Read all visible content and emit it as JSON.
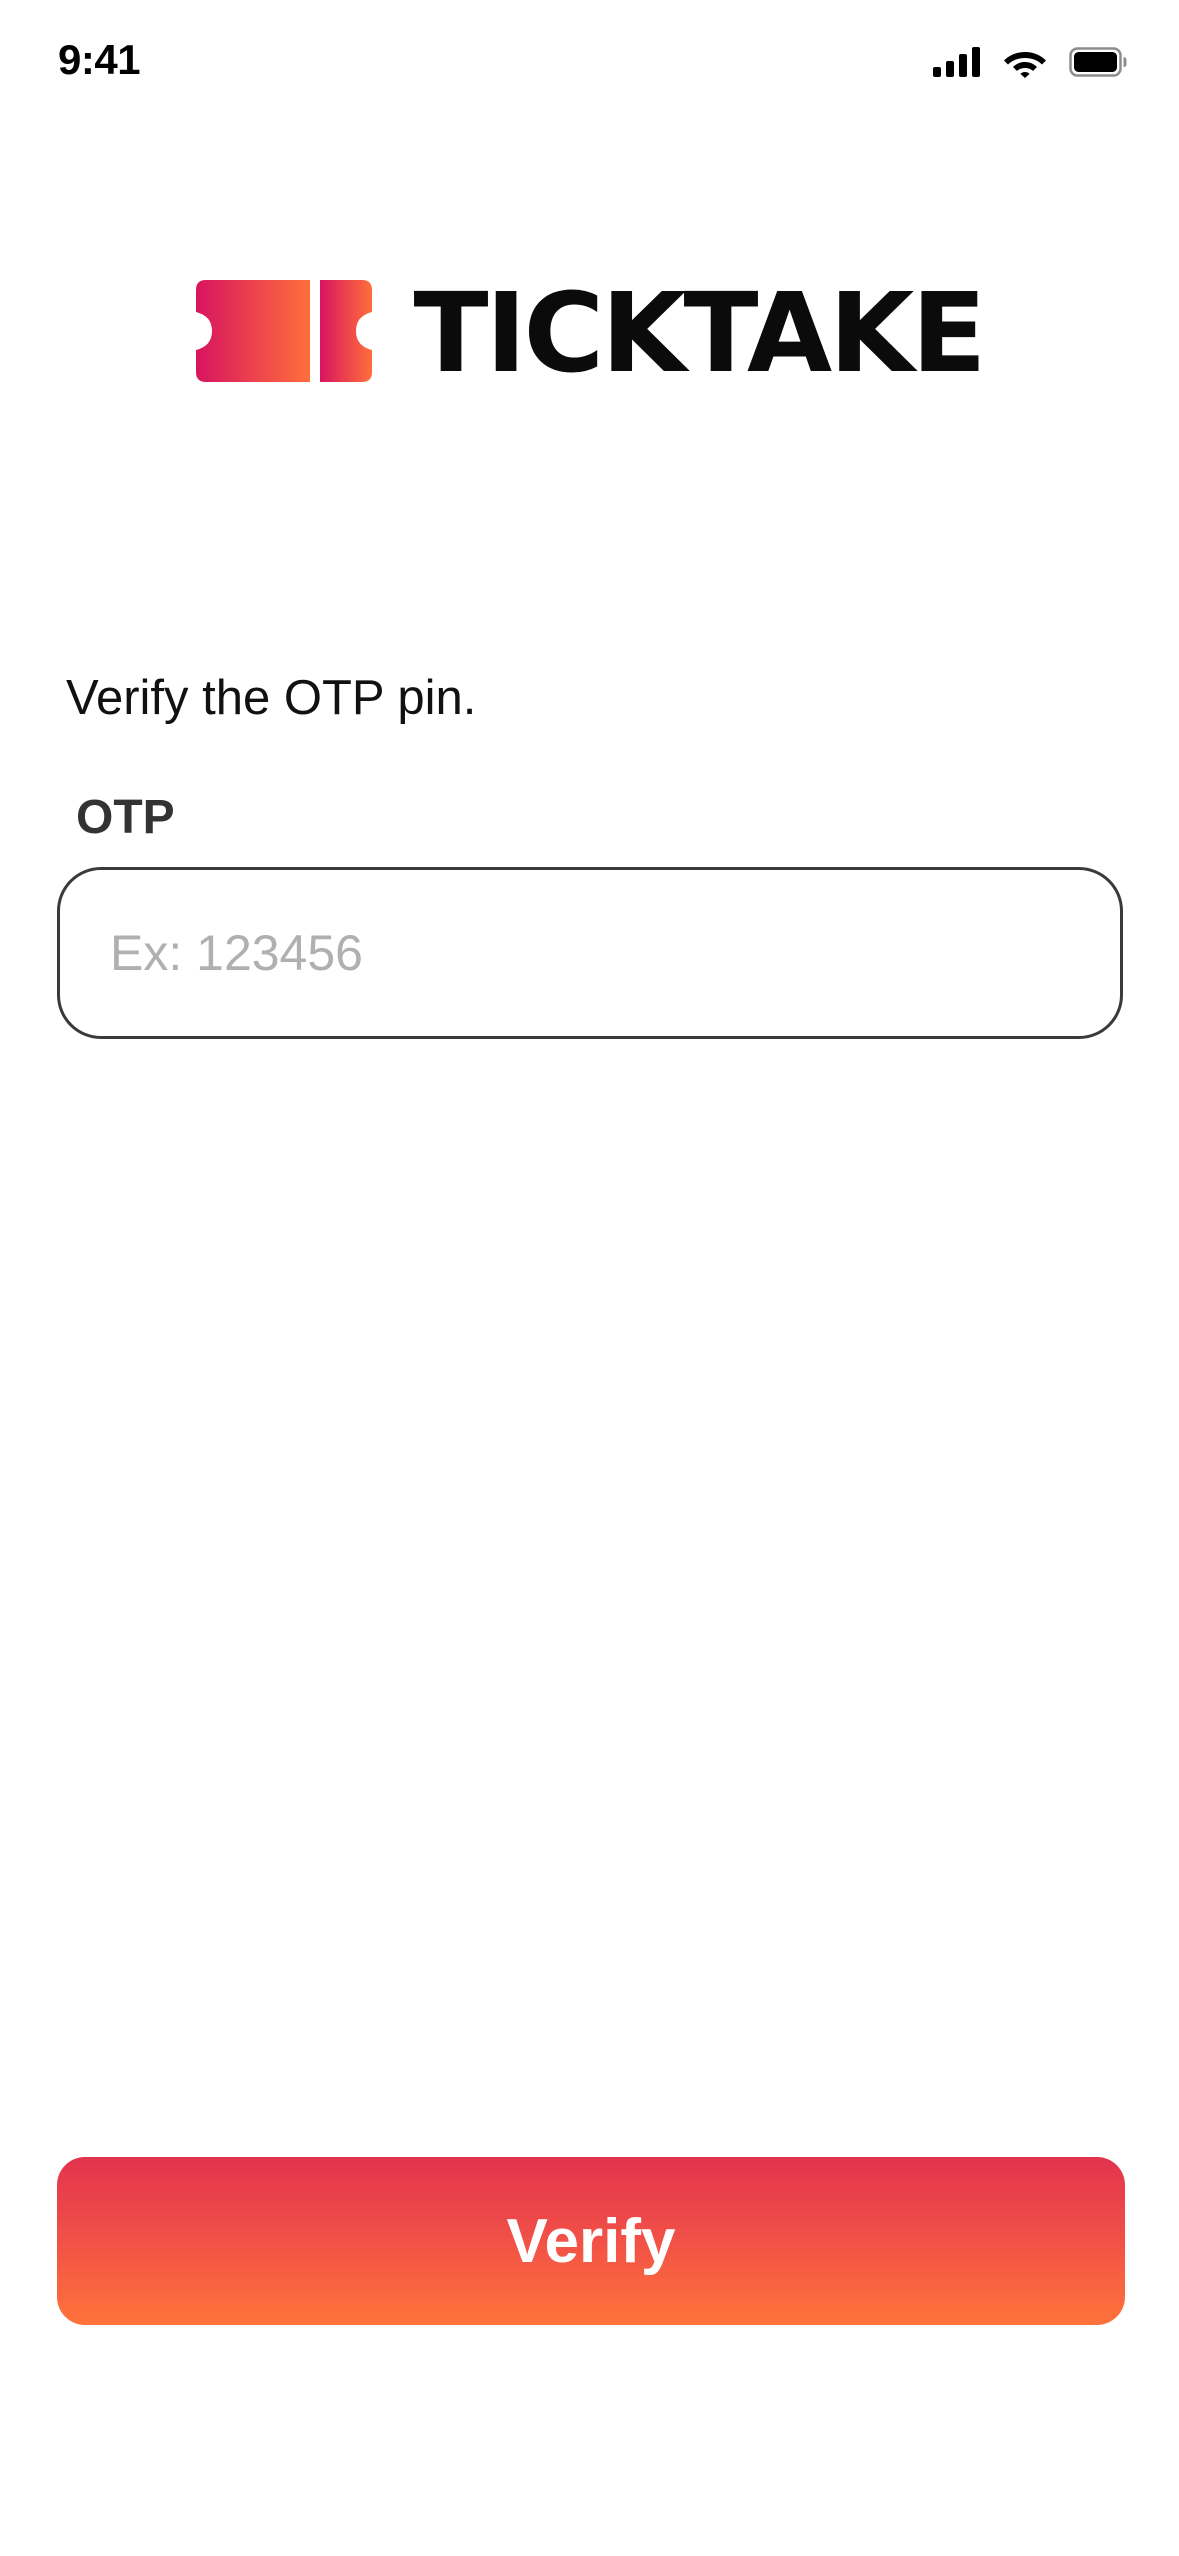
{
  "status_bar": {
    "time": "9:41",
    "icons": [
      "cellular-signal-icon",
      "wifi-icon",
      "battery-icon"
    ]
  },
  "logo": {
    "text": "TICKTAKE",
    "icon": "ticket-icon",
    "gradient": [
      "#d8145f",
      "#ff6f3c"
    ]
  },
  "instruction": "Verify the OTP pin.",
  "otp_field": {
    "label": "OTP",
    "placeholder": "Ex: 123456",
    "value": ""
  },
  "verify_button": {
    "label": "Verify",
    "gradient": [
      "#e2334e",
      "#ff733a"
    ]
  }
}
